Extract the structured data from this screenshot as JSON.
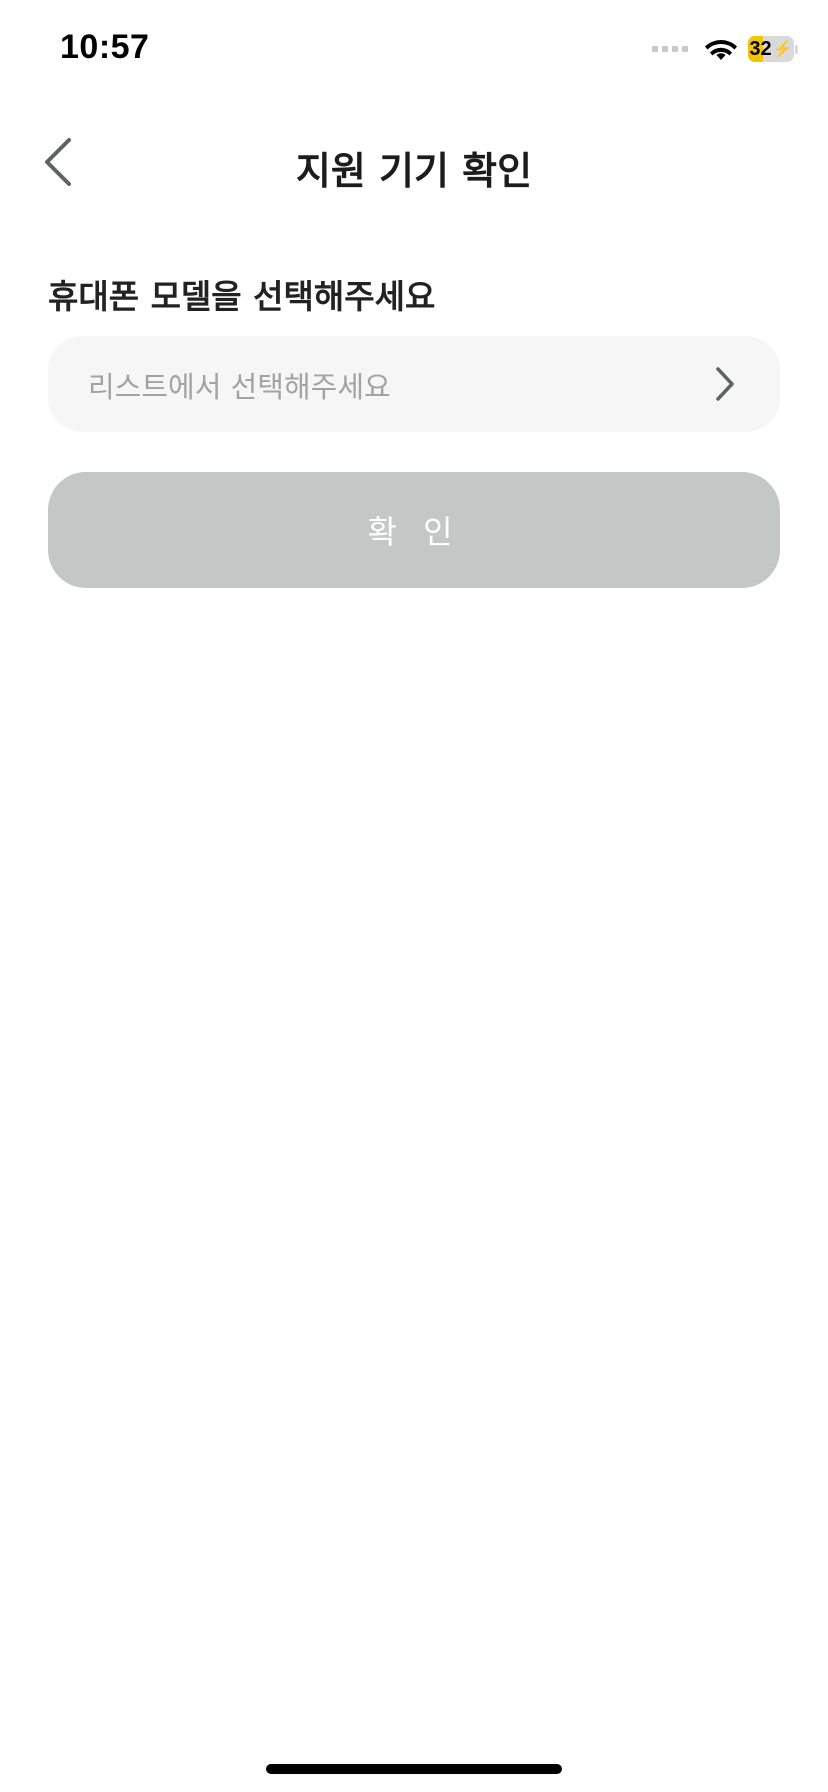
{
  "status_bar": {
    "time": "10:57",
    "battery_level": "32",
    "battery_charging": true,
    "battery_fill_percent": 32,
    "icons": [
      "signal-dots-icon",
      "wifi-icon",
      "battery-icon",
      "charging-bolt-icon"
    ]
  },
  "header": {
    "title": "지원 기기 확인",
    "back_icon": "chevron-left-icon"
  },
  "form": {
    "label": "휴대폰 모델을 선택해주세요",
    "select": {
      "placeholder": "리스트에서 선택해주세요",
      "value": "",
      "icon": "chevron-right-icon"
    },
    "confirm_label": "확 인",
    "confirm_disabled": true
  },
  "colors": {
    "background": "#ffffff",
    "title_text": "#1c1c1c",
    "select_background": "#f6f6f6",
    "placeholder_text": "#a3a3a3",
    "confirm_disabled_bg": "#c3c8c6",
    "confirm_text": "#ffffff",
    "battery_accent": "#f5c400",
    "chevron": "#5f6362"
  }
}
